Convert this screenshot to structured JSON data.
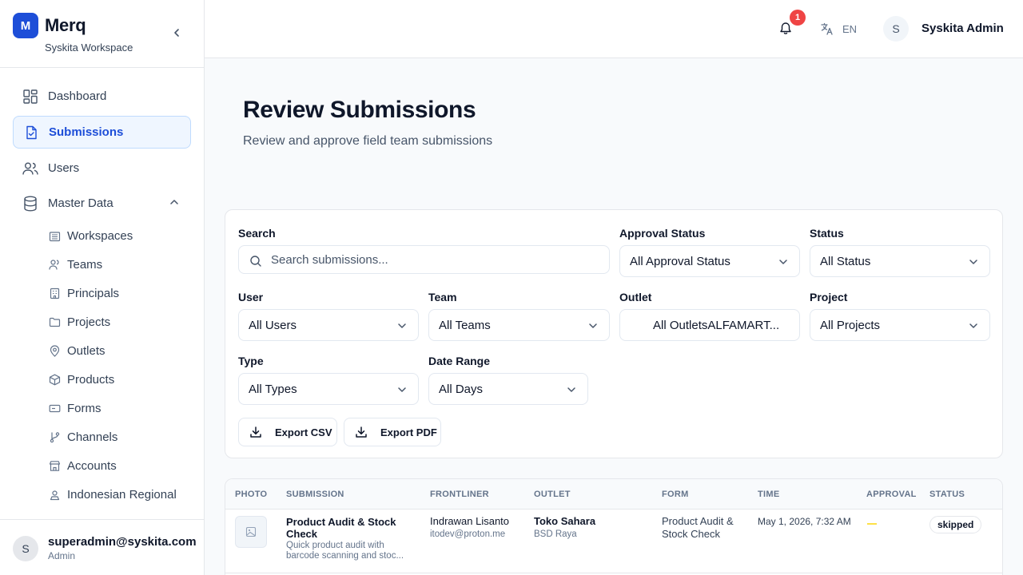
{
  "brand": {
    "logo_letter": "M",
    "name": "Merq",
    "workspace": "Syskita Workspace"
  },
  "sidebar": {
    "items": [
      {
        "label": "Dashboard",
        "icon": "dashboard-icon"
      },
      {
        "label": "Submissions",
        "icon": "file-check-icon",
        "active": true
      },
      {
        "label": "Users",
        "icon": "users-icon"
      },
      {
        "label": "Master Data",
        "icon": "database-icon",
        "expanded": true
      }
    ],
    "sub_items": [
      {
        "label": "Workspaces",
        "icon": "building-icon"
      },
      {
        "label": "Teams",
        "icon": "users-icon"
      },
      {
        "label": "Principals",
        "icon": "office-icon"
      },
      {
        "label": "Projects",
        "icon": "folder-icon"
      },
      {
        "label": "Outlets",
        "icon": "map-pin-icon"
      },
      {
        "label": "Products",
        "icon": "box-icon"
      },
      {
        "label": "Forms",
        "icon": "form-icon"
      },
      {
        "label": "Channels",
        "icon": "git-branch-icon"
      },
      {
        "label": "Accounts",
        "icon": "store-icon"
      },
      {
        "label": "Indonesian Regional",
        "icon": "map-user-icon"
      }
    ],
    "footer": {
      "avatar_letter": "S",
      "email": "superadmin@syskita.com",
      "role": "Admin"
    }
  },
  "topbar": {
    "notification_count": "1",
    "language": "EN",
    "avatar_letter": "S",
    "user_name": "Syskita Admin"
  },
  "header": {
    "title": "Review Submissions",
    "subtitle": "Review and approve field team submissions"
  },
  "filters": {
    "search": {
      "label": "Search",
      "placeholder": "Search submissions..."
    },
    "approval_status": {
      "label": "Approval Status",
      "value": "All Approval Status"
    },
    "status": {
      "label": "Status",
      "value": "All Status"
    },
    "user": {
      "label": "User",
      "value": "All Users"
    },
    "team": {
      "label": "Team",
      "value": "All Teams"
    },
    "outlet": {
      "label": "Outlet",
      "value": "All OutletsALFAMART..."
    },
    "project": {
      "label": "Project",
      "value": "All Projects"
    },
    "type": {
      "label": "Type",
      "value": "All Types"
    },
    "date_range": {
      "label": "Date Range",
      "value": "All Days"
    },
    "export_csv": "Export CSV",
    "export_pdf": "Export PDF"
  },
  "table": {
    "columns": [
      "PHOTO",
      "SUBMISSION",
      "FRONTLINER",
      "OUTLET",
      "FORM",
      "TIME",
      "APPROVAL",
      "STATUS"
    ],
    "rows": [
      {
        "submission_title": "Product Audit & Stock Check",
        "submission_desc": "Quick product audit with barcode scanning and stoc...",
        "frontliner_name": "Indrawan Lisanto",
        "frontliner_email": "itodev@proton.me",
        "outlet_name": "Toko Sahara",
        "outlet_area": "BSD Raya",
        "form": "Product Audit & Stock Check",
        "time": "May 1, 2026, 7:32 AM",
        "approval": "—",
        "status": "skipped"
      }
    ]
  },
  "colors": {
    "accent": "#1d4ed8",
    "badge": "#ef4444",
    "active_bg": "#eff6ff"
  }
}
